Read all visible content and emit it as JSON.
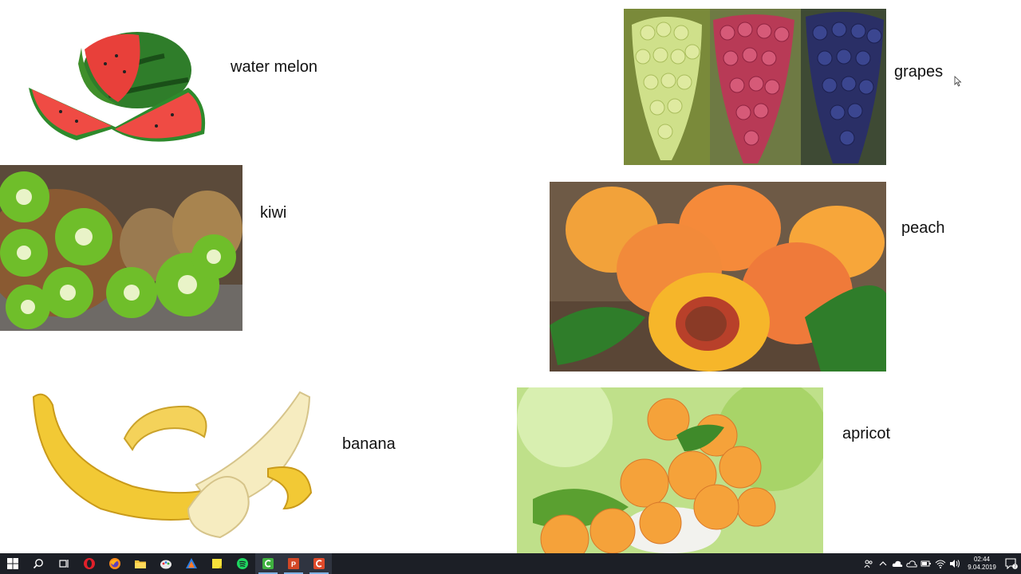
{
  "slide": {
    "fruits": [
      {
        "key": "watermelon",
        "label": "water melon"
      },
      {
        "key": "kiwi",
        "label": "kiwi"
      },
      {
        "key": "banana",
        "label": "banana"
      },
      {
        "key": "grapes",
        "label": "grapes"
      },
      {
        "key": "peach",
        "label": "peach"
      },
      {
        "key": "apricot",
        "label": "apricot"
      }
    ]
  },
  "taskbar": {
    "buttons": [
      {
        "icon": "windows-start-icon"
      },
      {
        "icon": "search-icon"
      },
      {
        "icon": "task-view-icon"
      },
      {
        "icon": "opera-icon"
      },
      {
        "icon": "firefox-icon"
      },
      {
        "icon": "file-explorer-icon"
      },
      {
        "icon": "paint-icon"
      },
      {
        "icon": "app-icon"
      },
      {
        "icon": "sticky-notes-icon"
      },
      {
        "icon": "spotify-icon"
      },
      {
        "icon": "camtasia-icon"
      },
      {
        "icon": "powerpoint-icon"
      },
      {
        "icon": "camtasia-recorder-icon"
      }
    ],
    "clock": {
      "time": "02:44",
      "date": "9.04.2019"
    },
    "notification_count": "7",
    "colors": {
      "background": "#1c1f26",
      "active_underline": "#7fb2e5"
    }
  }
}
